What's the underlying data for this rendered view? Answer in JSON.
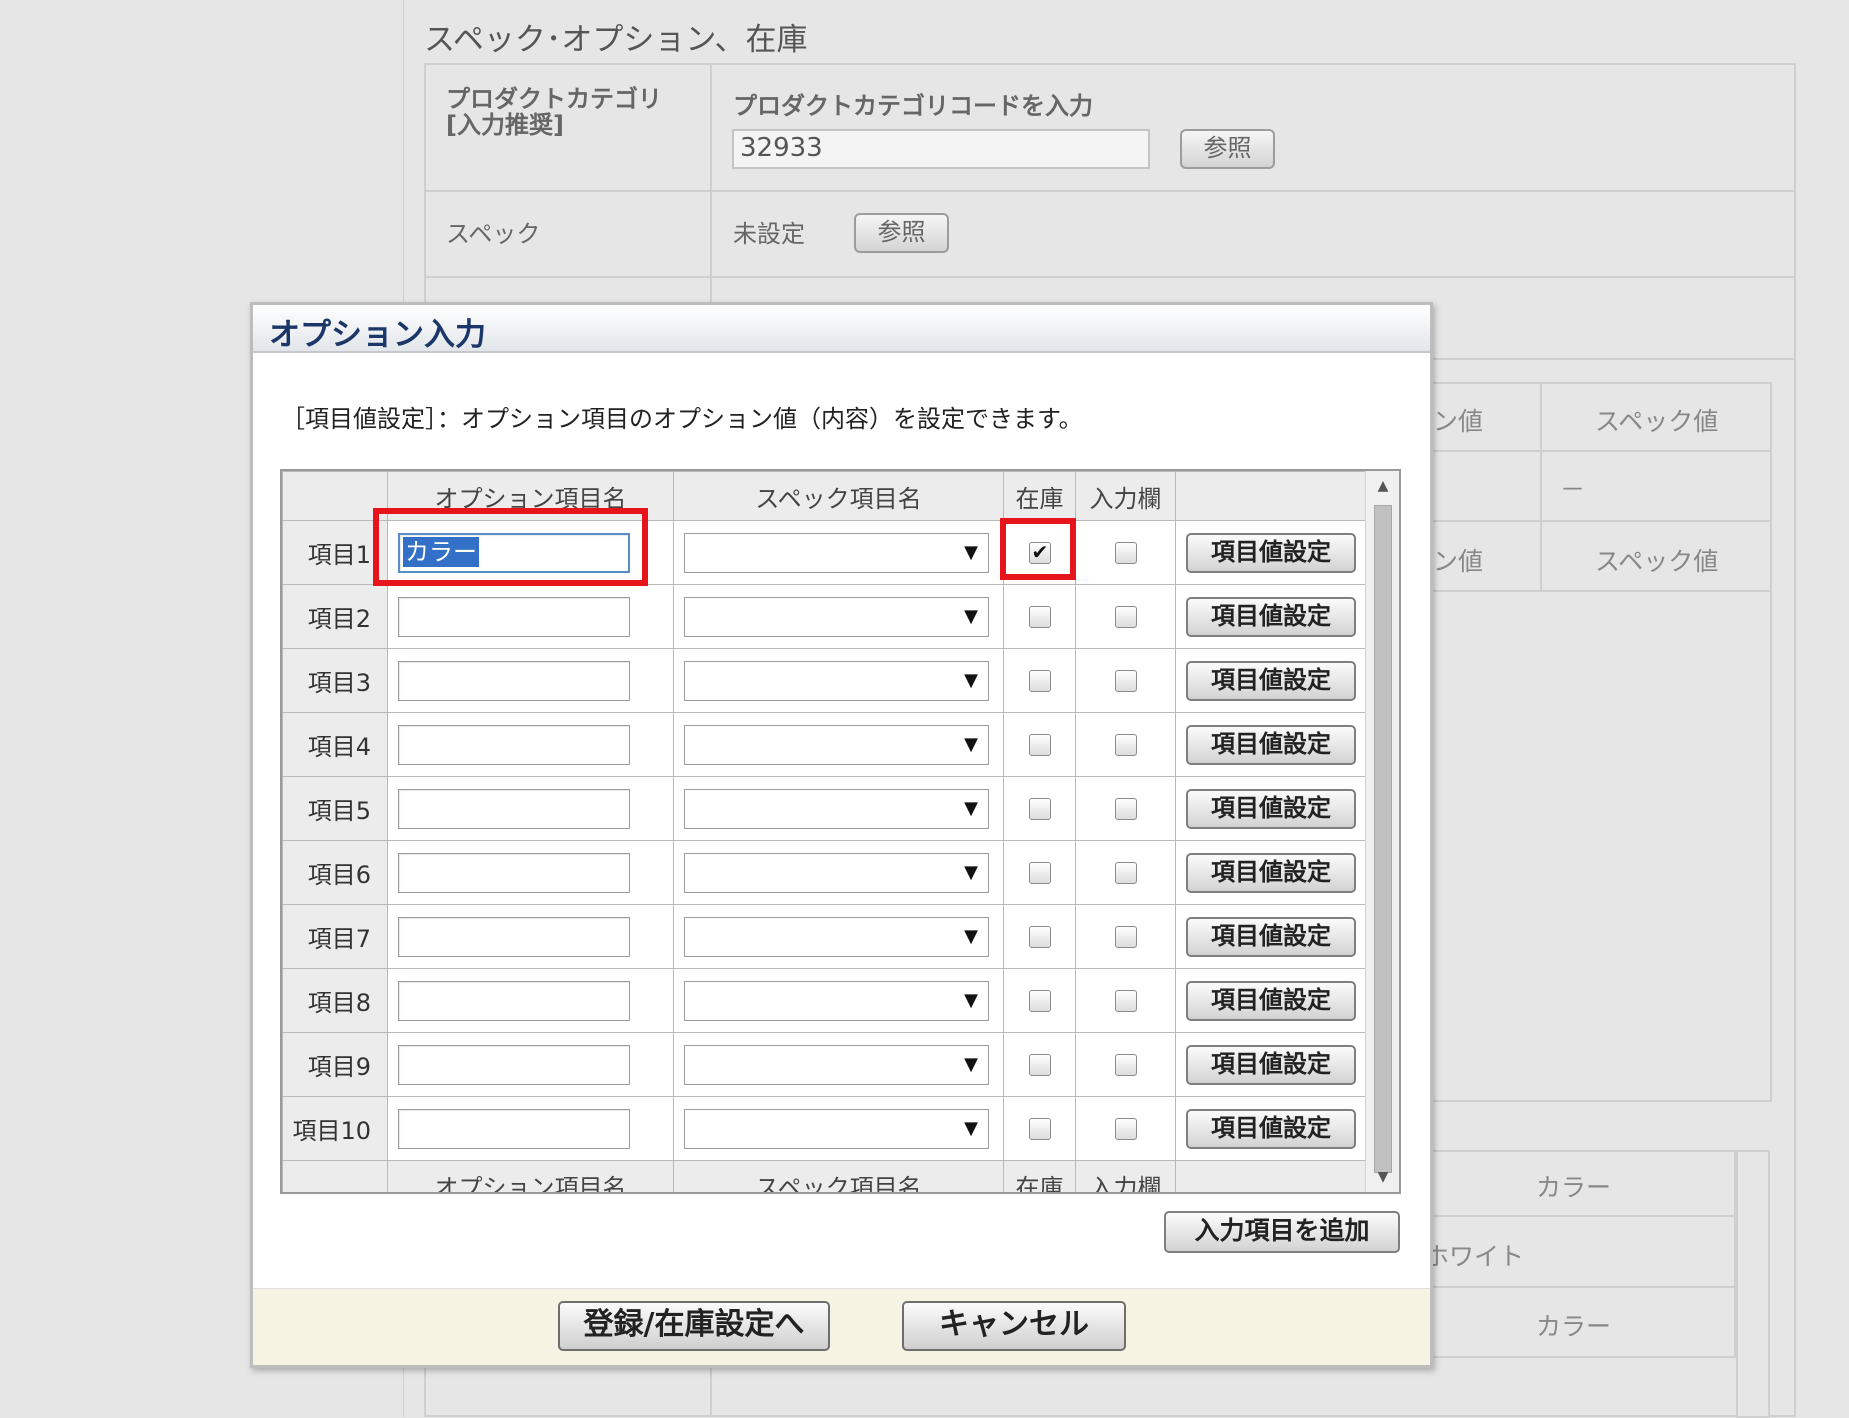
{
  "background": {
    "section_title": "スペック･オプション、在庫",
    "product_category_label": "プロダクトカテゴリ\n[入力推奨]",
    "product_category_prompt": "プロダクトカテゴリコードを入力",
    "product_category_value": "32933",
    "reference_button": "参照",
    "spec_label": "スペック",
    "spec_status": "未設定",
    "spec_reference_button": "参照",
    "right_grid": {
      "header_option_value_partial": "ン値",
      "header_spec_value": "スペック値",
      "dash": "－",
      "lower_rows": [
        "カラー",
        "ホワイト",
        "カラー"
      ]
    }
  },
  "modal": {
    "title": "オプション入力",
    "description": "［項目値設定］：オプション項目のオプション値（内容）を設定できます。",
    "columns": {
      "option_name": "オプション項目名",
      "spec_name": "スペック項目名",
      "stock": "在庫",
      "input_field": "入力欄"
    },
    "rows": [
      {
        "label": "項目1",
        "option_name": "カラー",
        "stock": true,
        "input": false,
        "button": "項目値設定"
      },
      {
        "label": "項目2",
        "option_name": "",
        "stock": false,
        "input": false,
        "button": "項目値設定"
      },
      {
        "label": "項目3",
        "option_name": "",
        "stock": false,
        "input": false,
        "button": "項目値設定"
      },
      {
        "label": "項目4",
        "option_name": "",
        "stock": false,
        "input": false,
        "button": "項目値設定"
      },
      {
        "label": "項目5",
        "option_name": "",
        "stock": false,
        "input": false,
        "button": "項目値設定"
      },
      {
        "label": "項目6",
        "option_name": "",
        "stock": false,
        "input": false,
        "button": "項目値設定"
      },
      {
        "label": "項目7",
        "option_name": "",
        "stock": false,
        "input": false,
        "button": "項目値設定"
      },
      {
        "label": "項目8",
        "option_name": "",
        "stock": false,
        "input": false,
        "button": "項目値設定"
      },
      {
        "label": "項目9",
        "option_name": "",
        "stock": false,
        "input": false,
        "button": "項目値設定"
      },
      {
        "label": "項目10",
        "option_name": "",
        "stock": false,
        "input": false,
        "button": "項目値設定"
      }
    ],
    "add_button": "入力項目を追加",
    "register_button": "登録/在庫設定へ",
    "cancel_button": "キャンセル",
    "dropdown_arrow": "▼",
    "highlight_color": "#e8141c"
  }
}
